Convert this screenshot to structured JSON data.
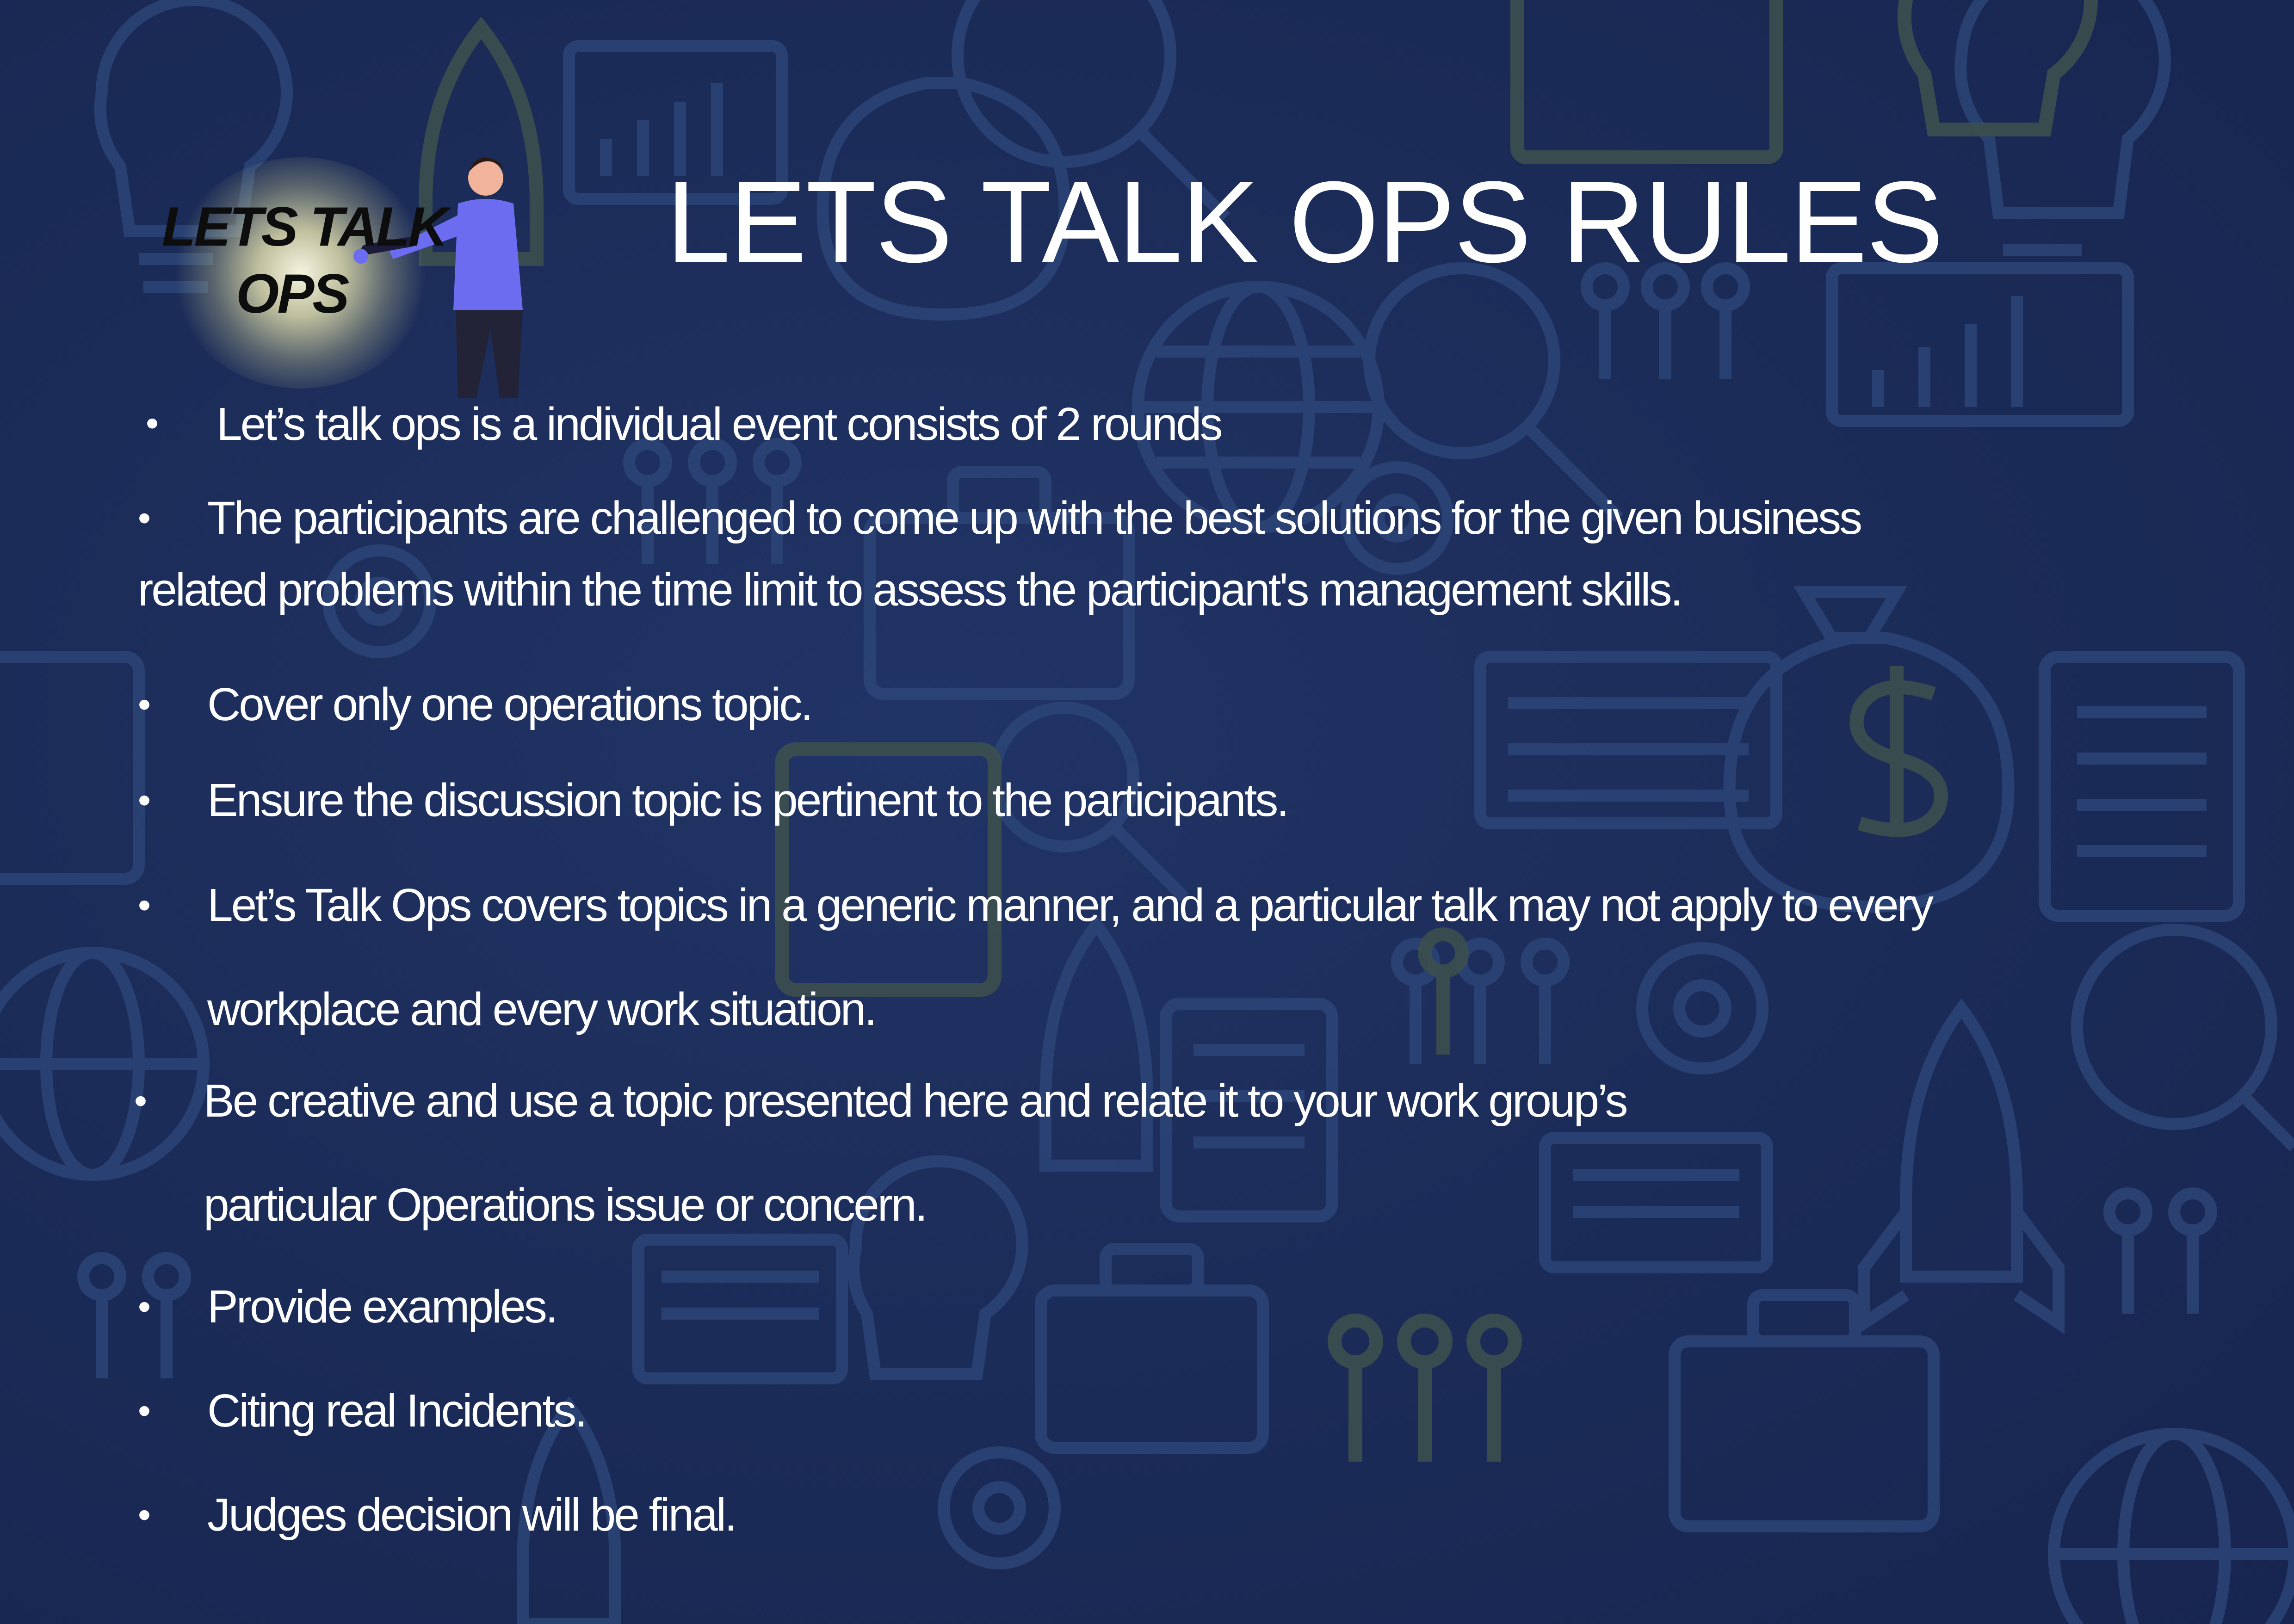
{
  "title": "LETS TALK OPS RULES",
  "logo": {
    "line1": "LETS TALK",
    "line2": "OPS"
  },
  "bullet_symbol": "•",
  "rules": [
    {
      "id": "rounds",
      "lines": [
        "Let’s talk ops is a individual event consists of 2 rounds"
      ]
    },
    {
      "id": "participants",
      "lines": [
        "The participants are challenged to come up with the best solutions for the given business",
        "related problems within the time limit to assess the participant's management skills."
      ]
    },
    {
      "id": "one-topic",
      "lines": [
        "Cover only one operations topic."
      ]
    },
    {
      "id": "pertinent",
      "lines": [
        "Ensure the discussion topic is pertinent to the participants."
      ]
    },
    {
      "id": "generic",
      "lines": [
        "Let’s Talk Ops covers topics in a  generic manner, and a particular talk may not apply to every",
        "workplace and every work situation."
      ]
    },
    {
      "id": "creative",
      "lines": [
        "Be creative and use a topic presented here and relate it to your work group’s",
        "particular Operations issue or concern."
      ]
    },
    {
      "id": "examples",
      "lines": [
        "Provide examples."
      ]
    },
    {
      "id": "incidents",
      "lines": [
        "Citing real Incidents."
      ]
    },
    {
      "id": "judges",
      "lines": [
        "Judges decision will be final."
      ]
    }
  ],
  "colors": {
    "background": "#1b2b57",
    "text": "#ffffff",
    "pattern": "#2c4577",
    "pattern_accent": "#3c4f4e"
  }
}
